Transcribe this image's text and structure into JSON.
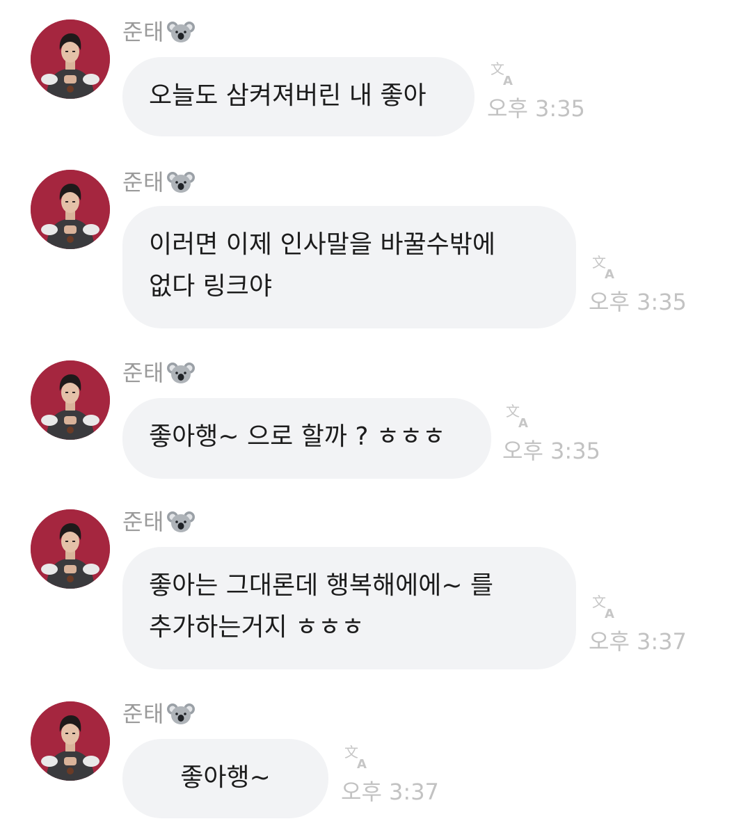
{
  "messages": [
    {
      "sender": "준태",
      "text": "오늘도 삼켜져버린 내 좋아",
      "time": "오후 3:35"
    },
    {
      "sender": "준태",
      "text": "이러면 이제 인사말을 바꿀수밖에\n없다 링크야",
      "time": "오후 3:35"
    },
    {
      "sender": "준태",
      "text": "좋아행~ 으로 할까 ? ㅎㅎㅎ",
      "time": "오후 3:35"
    },
    {
      "sender": "준태",
      "text": "좋아는 그대론데 행복해에에~ 를\n추가하는거지 ㅎㅎㅎ",
      "time": "오후 3:37"
    },
    {
      "sender": "준태",
      "text": "좋아행~",
      "time": "오후 3:37"
    }
  ],
  "icons": {
    "sender_badge": "koala-icon",
    "translate": "translate-icon",
    "avatar": "profile-photo"
  },
  "colors": {
    "bubble": "#f2f3f5",
    "time": "#c2c2c2",
    "sender": "#9a9a9a",
    "avatar_bg": "#a5263f"
  }
}
